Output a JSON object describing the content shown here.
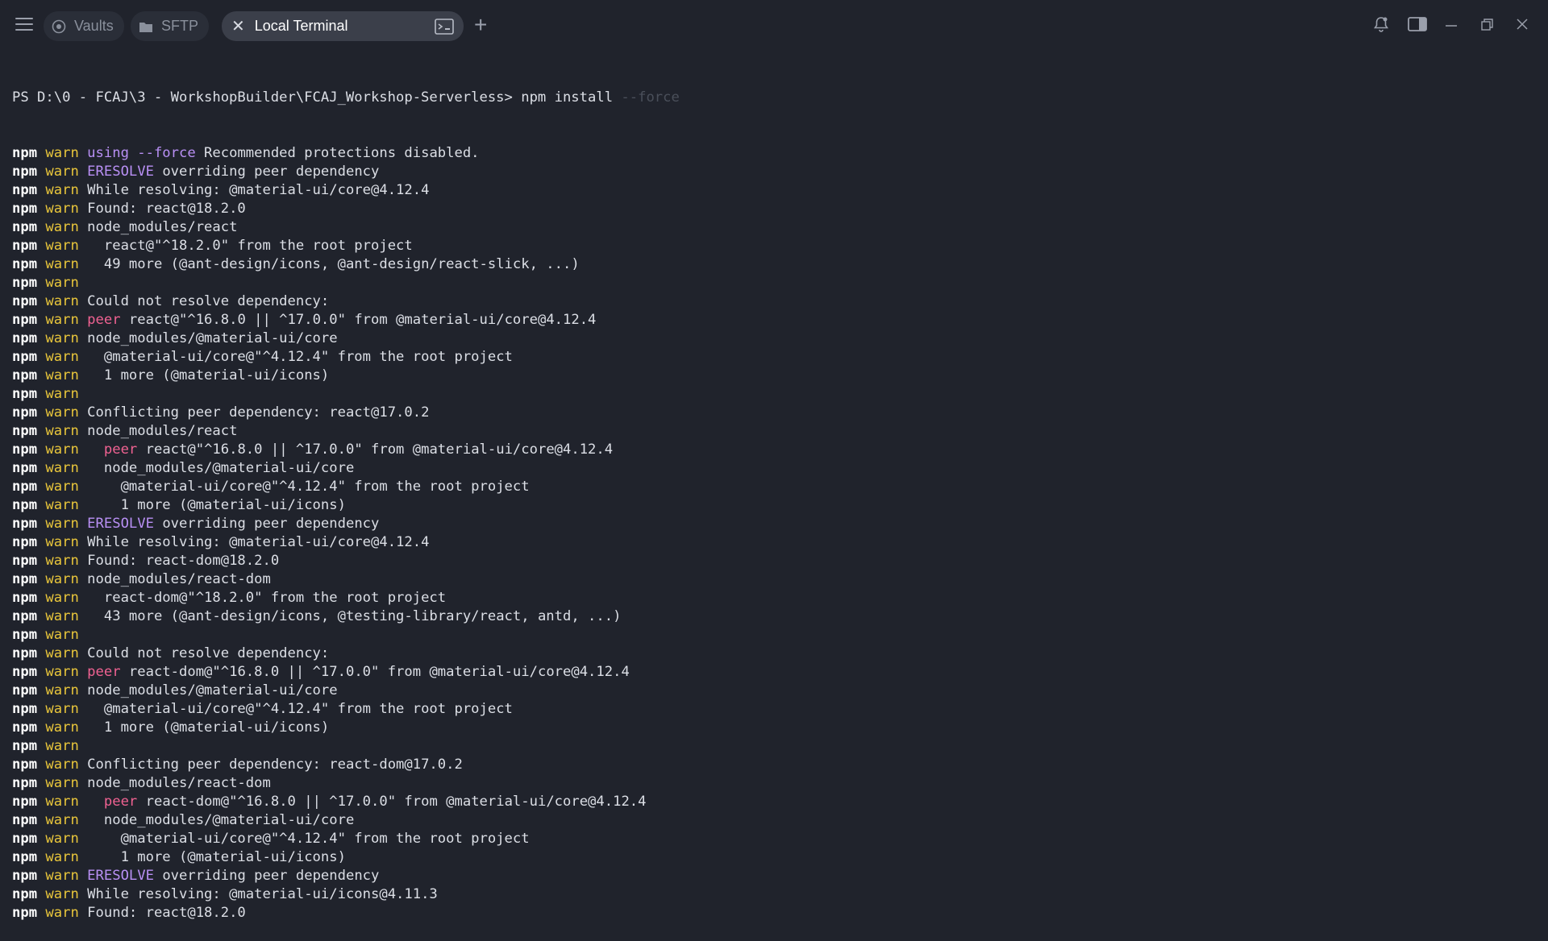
{
  "tabs": {
    "vaults_label": "Vaults",
    "sftp_label": "SFTP",
    "active_label": "Local Terminal",
    "add_tab_symbol": "+"
  },
  "terminal": {
    "prompt": "PS D:\\0 - FCAJ\\3 - WorkshopBuilder\\FCAJ_Workshop-Serverless>",
    "command": " npm install ",
    "command_hint": "--force",
    "npm_label": "npm",
    "warn_label": "warn",
    "lines": [
      [
        {
          "t": "using --force",
          "c": "kw"
        },
        {
          "t": " Recommended protections disabled.",
          "c": "txt"
        }
      ],
      [
        {
          "t": "ERESOLVE",
          "c": "kw"
        },
        {
          "t": " overriding peer dependency",
          "c": "txt"
        }
      ],
      [
        {
          "t": "While resolving: @material-ui/core@4.12.4",
          "c": "txt"
        }
      ],
      [
        {
          "t": "Found: react@18.2.0",
          "c": "txt"
        }
      ],
      [
        {
          "t": "node_modules/react",
          "c": "txt"
        }
      ],
      [
        {
          "t": "  react@\"^18.2.0\" from the root project",
          "c": "txt"
        }
      ],
      [
        {
          "t": "  49 more (@ant-design/icons, @ant-design/react-slick, ...)",
          "c": "txt"
        }
      ],
      [],
      [
        {
          "t": "Could not resolve dependency:",
          "c": "txt"
        }
      ],
      [
        {
          "t": "peer",
          "c": "peer"
        },
        {
          "t": " react@\"^16.8.0 || ^17.0.0\" from @material-ui/core@4.12.4",
          "c": "txt"
        }
      ],
      [
        {
          "t": "node_modules/@material-ui/core",
          "c": "txt"
        }
      ],
      [
        {
          "t": "  @material-ui/core@\"^4.12.4\" from the root project",
          "c": "txt"
        }
      ],
      [
        {
          "t": "  1 more (@material-ui/icons)",
          "c": "txt"
        }
      ],
      [],
      [
        {
          "t": "Conflicting peer dependency: react@17.0.2",
          "c": "txt"
        }
      ],
      [
        {
          "t": "node_modules/react",
          "c": "txt"
        }
      ],
      [
        {
          "t": "  ",
          "c": "txt"
        },
        {
          "t": "peer",
          "c": "peer"
        },
        {
          "t": " react@\"^16.8.0 || ^17.0.0\" from @material-ui/core@4.12.4",
          "c": "txt"
        }
      ],
      [
        {
          "t": "  node_modules/@material-ui/core",
          "c": "txt"
        }
      ],
      [
        {
          "t": "    @material-ui/core@\"^4.12.4\" from the root project",
          "c": "txt"
        }
      ],
      [
        {
          "t": "    1 more (@material-ui/icons)",
          "c": "txt"
        }
      ],
      [
        {
          "t": "ERESOLVE",
          "c": "kw"
        },
        {
          "t": " overriding peer dependency",
          "c": "txt"
        }
      ],
      [
        {
          "t": "While resolving: @material-ui/core@4.12.4",
          "c": "txt"
        }
      ],
      [
        {
          "t": "Found: react-dom@18.2.0",
          "c": "txt"
        }
      ],
      [
        {
          "t": "node_modules/react-dom",
          "c": "txt"
        }
      ],
      [
        {
          "t": "  react-dom@\"^18.2.0\" from the root project",
          "c": "txt"
        }
      ],
      [
        {
          "t": "  43 more (@ant-design/icons, @testing-library/react, antd, ...)",
          "c": "txt"
        }
      ],
      [],
      [
        {
          "t": "Could not resolve dependency:",
          "c": "txt"
        }
      ],
      [
        {
          "t": "peer",
          "c": "peer"
        },
        {
          "t": " react-dom@\"^16.8.0 || ^17.0.0\" from @material-ui/core@4.12.4",
          "c": "txt"
        }
      ],
      [
        {
          "t": "node_modules/@material-ui/core",
          "c": "txt"
        }
      ],
      [
        {
          "t": "  @material-ui/core@\"^4.12.4\" from the root project",
          "c": "txt"
        }
      ],
      [
        {
          "t": "  1 more (@material-ui/icons)",
          "c": "txt"
        }
      ],
      [],
      [
        {
          "t": "Conflicting peer dependency: react-dom@17.0.2",
          "c": "txt"
        }
      ],
      [
        {
          "t": "node_modules/react-dom",
          "c": "txt"
        }
      ],
      [
        {
          "t": "  ",
          "c": "txt"
        },
        {
          "t": "peer",
          "c": "peer"
        },
        {
          "t": " react-dom@\"^16.8.0 || ^17.0.0\" from @material-ui/core@4.12.4",
          "c": "txt"
        }
      ],
      [
        {
          "t": "  node_modules/@material-ui/core",
          "c": "txt"
        }
      ],
      [
        {
          "t": "    @material-ui/core@\"^4.12.4\" from the root project",
          "c": "txt"
        }
      ],
      [
        {
          "t": "    1 more (@material-ui/icons)",
          "c": "txt"
        }
      ],
      [
        {
          "t": "ERESOLVE",
          "c": "kw"
        },
        {
          "t": " overriding peer dependency",
          "c": "txt"
        }
      ],
      [
        {
          "t": "While resolving: @material-ui/icons@4.11.3",
          "c": "txt"
        }
      ],
      [
        {
          "t": "Found: react@18.2.0",
          "c": "txt"
        }
      ]
    ]
  },
  "colors": {
    "background": "#20232c",
    "npm": "#ffffff",
    "warn": "#e9c63b",
    "keyword": "#b990f5",
    "peer": "#f06292"
  },
  "icons": [
    "menu-icon",
    "vaults-icon",
    "folder-icon",
    "close-icon",
    "terminal-icon",
    "bell-icon",
    "panel-icon",
    "minimize-icon",
    "restore-icon",
    "window-close-icon"
  ]
}
